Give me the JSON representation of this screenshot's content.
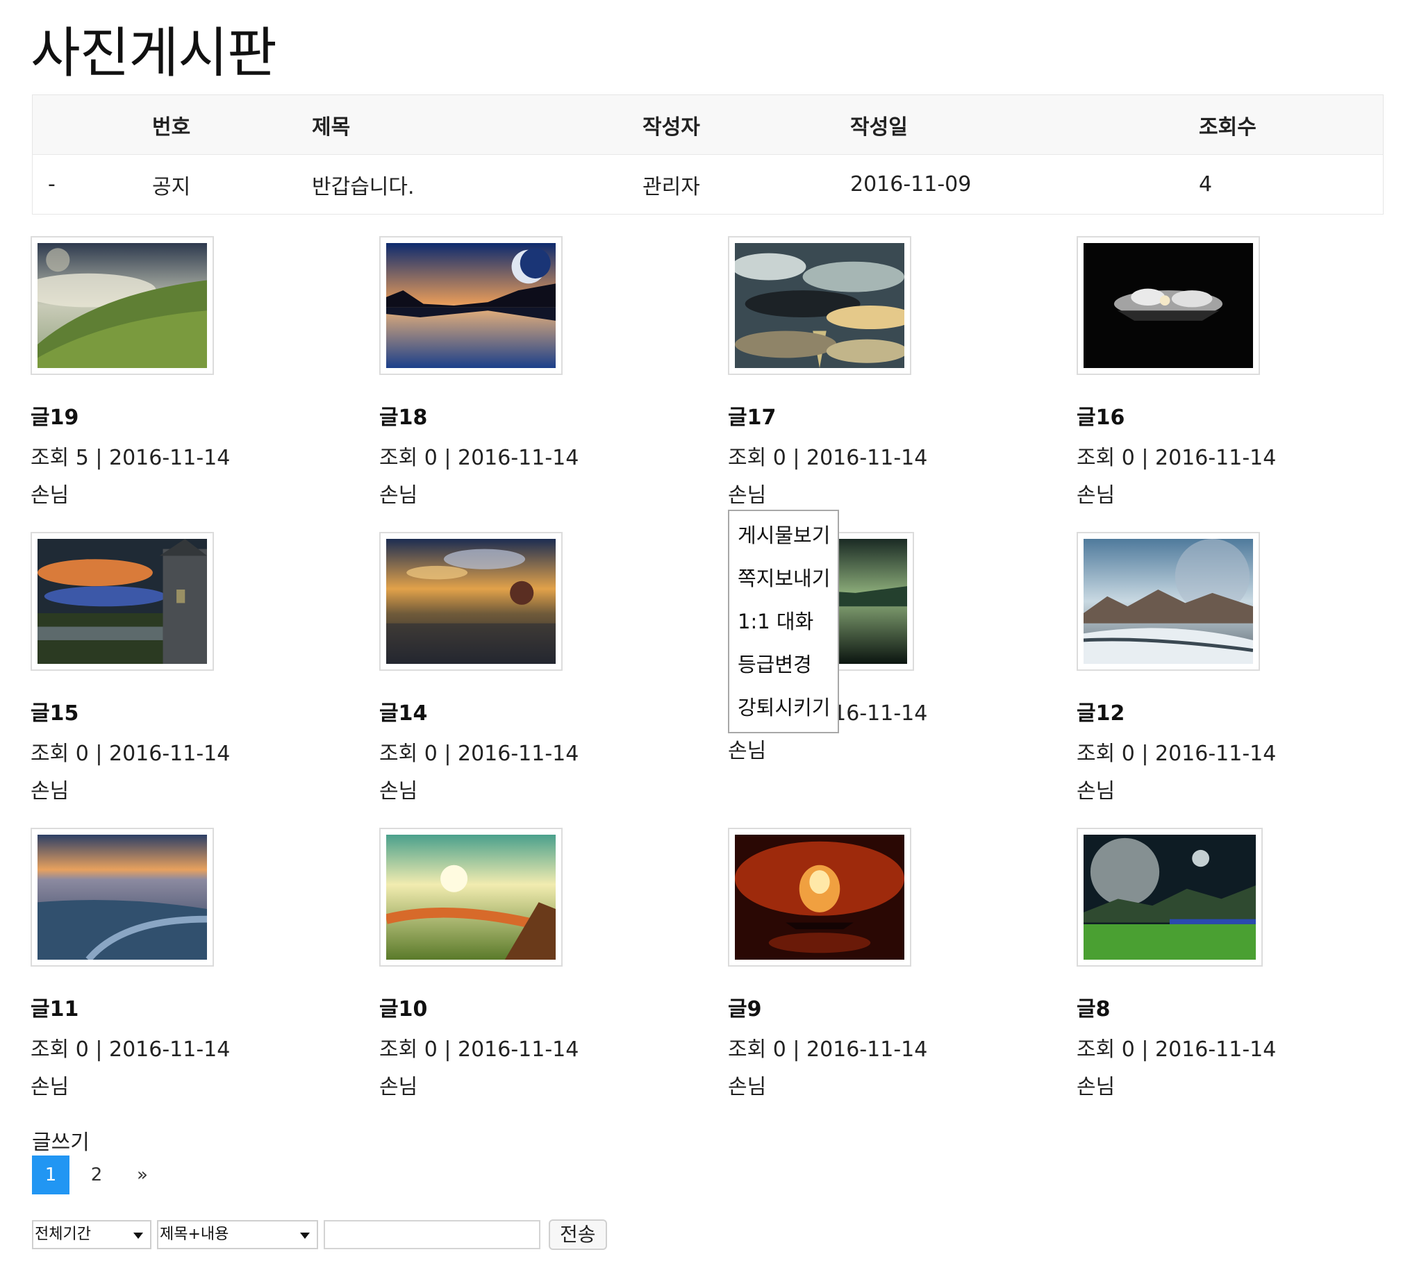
{
  "page_title": "사진게시판",
  "notice_table": {
    "headers": [
      "번호",
      "제목",
      "작성자",
      "작성일",
      "조회수"
    ],
    "row": {
      "dash": "-",
      "number": "공지",
      "title": "반갑습니다.",
      "author": "관리자",
      "date": "2016-11-09",
      "views": "4"
    }
  },
  "posts": [
    {
      "title": "글19",
      "meta": "조회 5 | 2016-11-14",
      "author": "손님",
      "image": "green-hills-with-moon"
    },
    {
      "title": "글18",
      "meta": "조회 0 | 2016-11-14",
      "author": "손님",
      "image": "blue-lake-with-moon"
    },
    {
      "title": "글17",
      "meta": "조회 0 | 2016-11-14",
      "author": "손님",
      "image": "cloudy-sky-sunburst"
    },
    {
      "title": "글16",
      "meta": "조회 0 | 2016-11-14",
      "author": "손님",
      "image": "dark-island-in-clouds"
    },
    {
      "title": "글15",
      "meta": "조회 0 | 2016-11-14",
      "author": "손님",
      "image": "castle-tower-and-bridge"
    },
    {
      "title": "글14",
      "meta": "조회 0 | 2016-11-14",
      "author": "손님",
      "image": "sunset-beach-couple"
    },
    {
      "title": "",
      "meta": "조회 0 | 2016-11-14",
      "author": "손님",
      "image": "green-dark-water"
    },
    {
      "title": "글12",
      "meta": "조회 0 | 2016-11-14",
      "author": "손님",
      "image": "snowy-mountains-with-planet"
    },
    {
      "title": "글11",
      "meta": "조회 0 | 2016-11-14",
      "author": "손님",
      "image": "beach-dusk"
    },
    {
      "title": "글10",
      "meta": "조회 0 | 2016-11-14",
      "author": "손님",
      "image": "fantasy-green-valley"
    },
    {
      "title": "글9",
      "meta": "조회 0 | 2016-11-14",
      "author": "손님",
      "image": "red-explosion-island"
    },
    {
      "title": "글8",
      "meta": "조회 0 | 2016-11-14",
      "author": "손님",
      "image": "moon-over-green-field"
    }
  ],
  "context_menu": [
    "게시물보기",
    "쪽지보내기",
    "1:1 대화",
    "등급변경",
    "강퇴시키기"
  ],
  "write_label": "글쓰기",
  "pagination": {
    "pages": [
      "1",
      "2"
    ],
    "active": "1",
    "next": "»"
  },
  "search": {
    "period": "전체기간",
    "field": "제목+내용",
    "query": "",
    "submit": "전송"
  },
  "colors": {
    "active_page": "#2196f3"
  }
}
